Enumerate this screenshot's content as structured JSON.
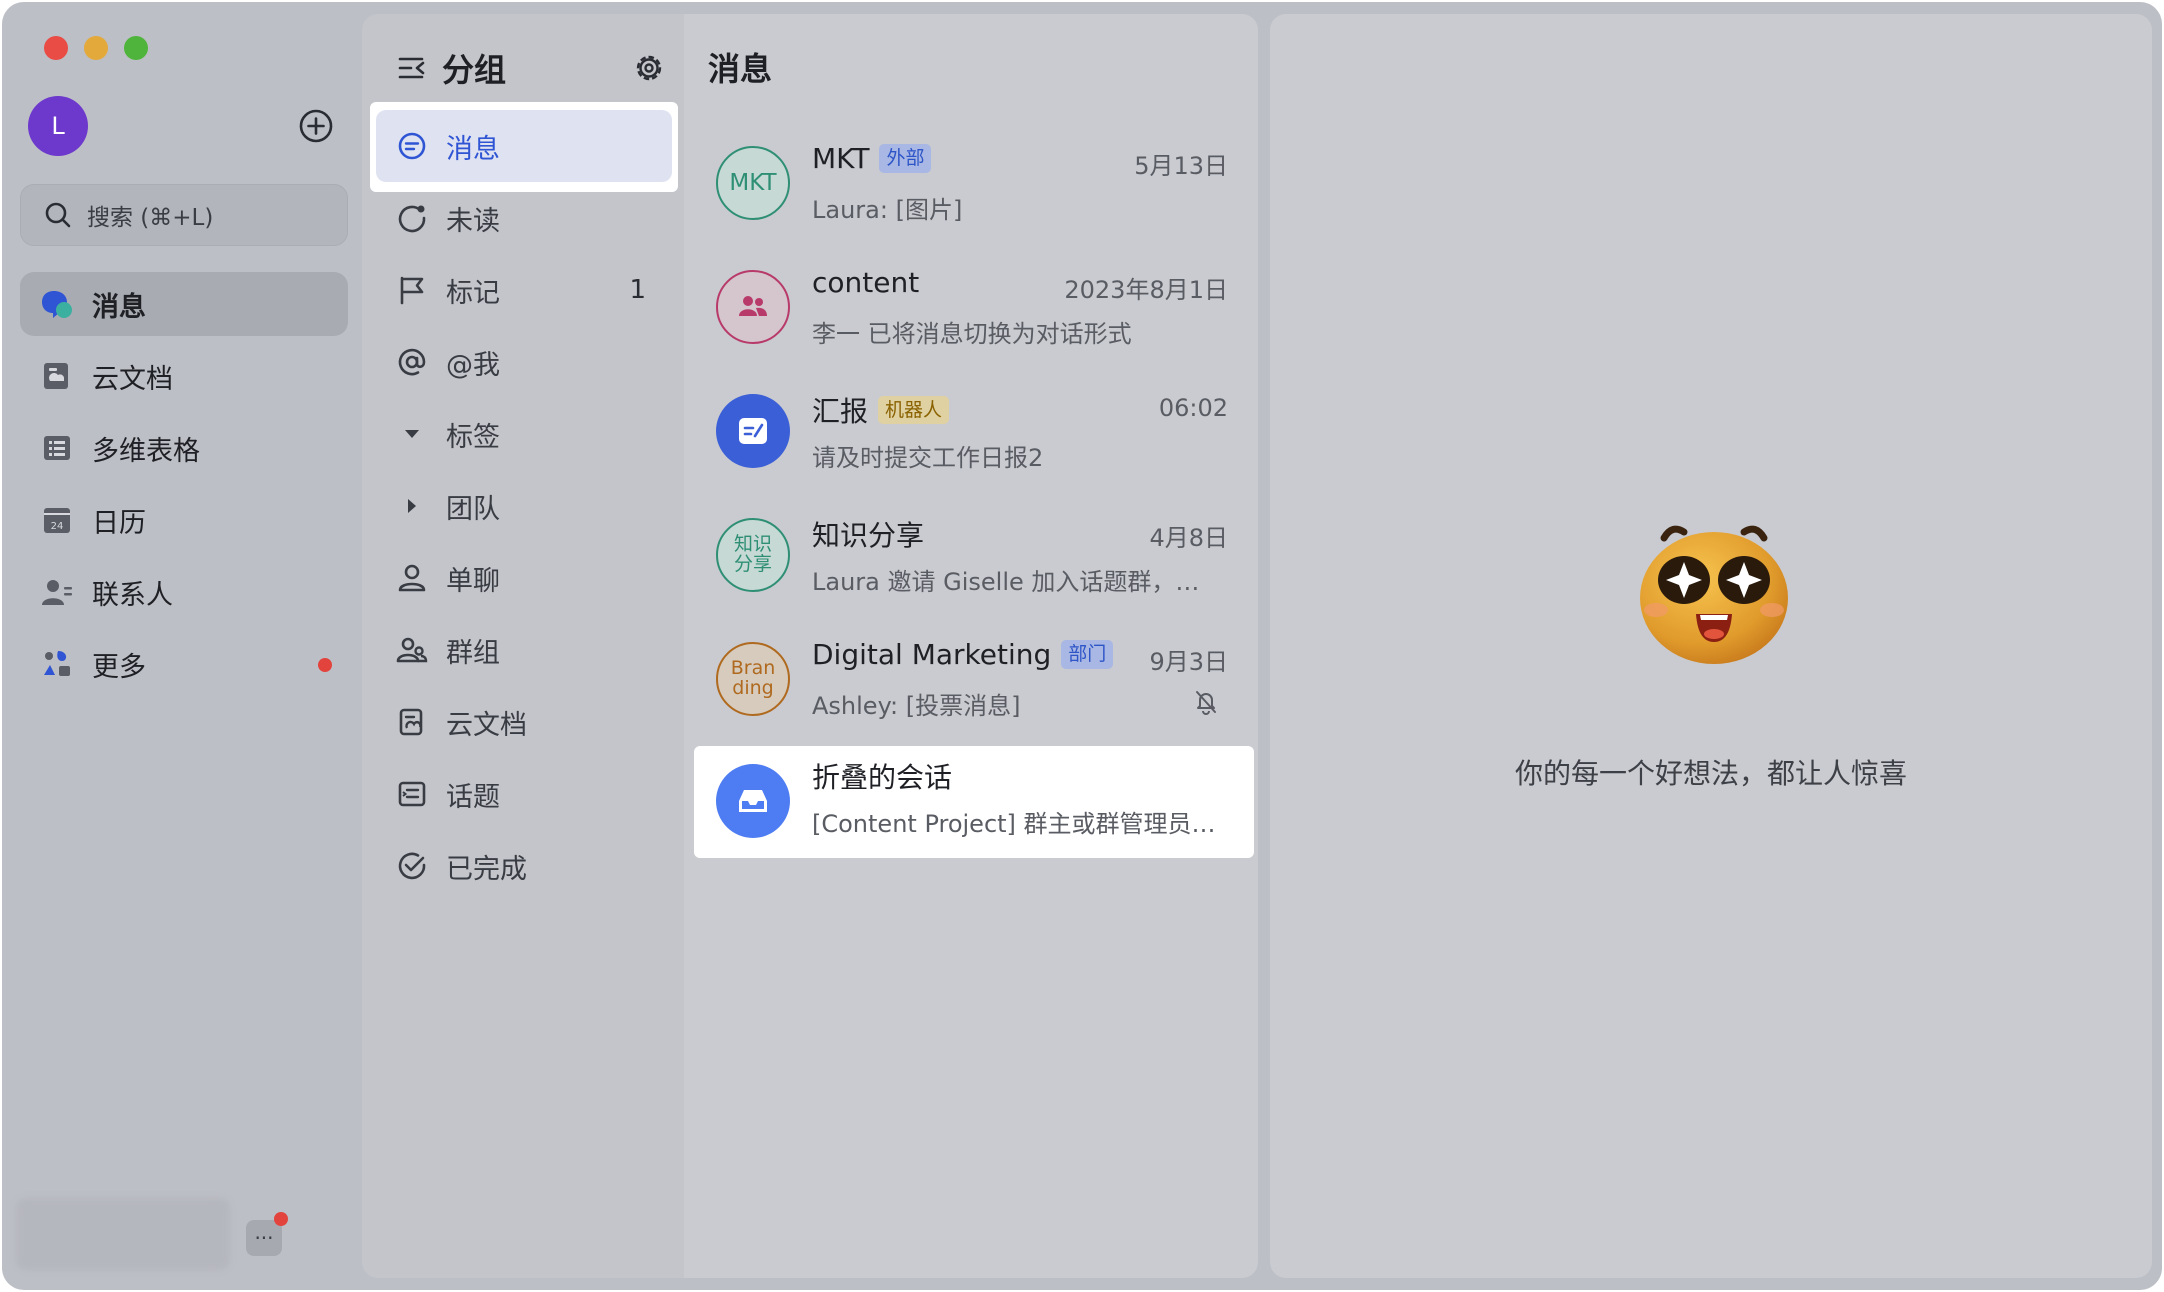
{
  "sidebar": {
    "avatar_letter": "L",
    "search_placeholder": "搜索 (⌘+L)",
    "nav": [
      {
        "label": "消息"
      },
      {
        "label": "云文档"
      },
      {
        "label": "多维表格"
      },
      {
        "label": "日历"
      },
      {
        "label": "联系人"
      },
      {
        "label": "更多"
      }
    ],
    "more_button": "···"
  },
  "groups": {
    "title": "分组",
    "items": [
      {
        "label": "消息"
      },
      {
        "label": "未读"
      },
      {
        "label": "标记",
        "count": "1"
      },
      {
        "label": "@我"
      },
      {
        "label": "标签"
      },
      {
        "label": "团队"
      },
      {
        "label": "单聊"
      },
      {
        "label": "群组"
      },
      {
        "label": "云文档"
      },
      {
        "label": "话题"
      },
      {
        "label": "已完成"
      }
    ]
  },
  "conversations": {
    "title": "消息",
    "items": [
      {
        "avatar_text": "MKT",
        "name": "MKT",
        "badge": "外部",
        "time": "5月13日",
        "preview": "Laura: [图片]"
      },
      {
        "avatar_text": "",
        "name": "content",
        "badge": "",
        "time": "2023年8月1日",
        "preview": "李一 已将消息切换为对话形式"
      },
      {
        "avatar_text": "",
        "name": "汇报",
        "badge": "机器人",
        "time": "06:02",
        "preview": "请及时提交工作日报2"
      },
      {
        "avatar_text": "知识 分享",
        "avatar_line1": "知识",
        "avatar_line2": "分享",
        "name": "知识分享",
        "badge": "",
        "time": "4月8日",
        "preview": "Laura 邀请 Giselle 加入话题群，新..."
      },
      {
        "avatar_text": "Bran ding",
        "avatar_line1": "Bran",
        "avatar_line2": "ding",
        "name": "Digital Marketing",
        "badge": "部门",
        "time": "9月3日",
        "preview": "Ashley: [投票消息]"
      },
      {
        "avatar_text": "",
        "name": "折叠的会话",
        "badge": "",
        "time": "",
        "preview": "[Content Project] 群主或群管理员开..."
      }
    ]
  },
  "main": {
    "empty_text": "你的每一个好想法，都让人惊喜"
  },
  "colors": {
    "accent": "#2f55d4",
    "selected_group_bg": "#dfe3f1",
    "avatar_purple": "#6d39cc",
    "notification_red": "#e2443d"
  }
}
